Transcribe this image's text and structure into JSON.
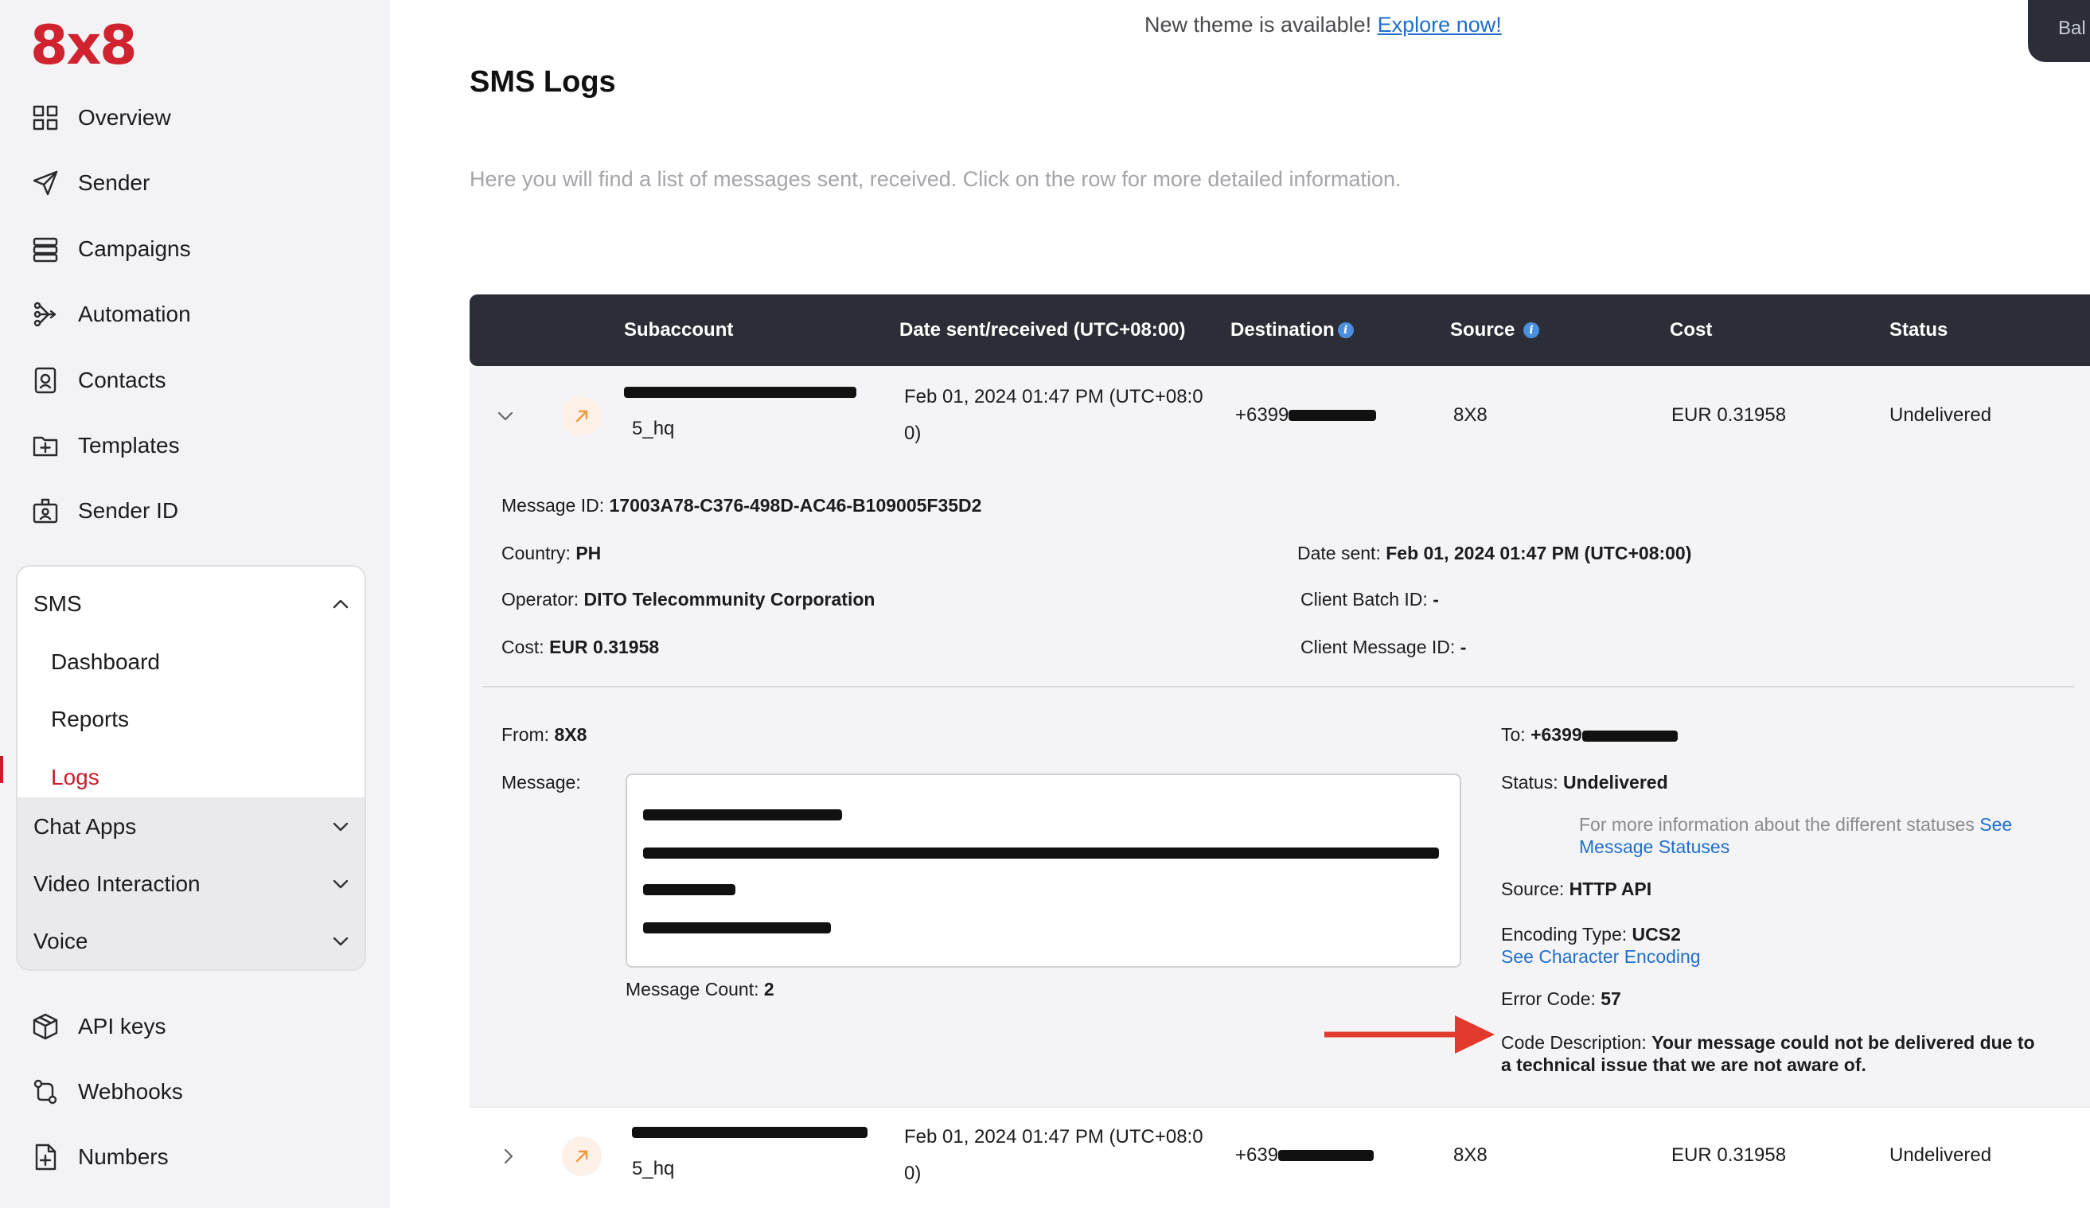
{
  "app": {
    "logo": "8x8"
  },
  "sidebar": {
    "items": [
      {
        "label": "Overview",
        "icon": "grid-icon"
      },
      {
        "label": "Sender",
        "icon": "send-icon"
      },
      {
        "label": "Campaigns",
        "icon": "stack-icon"
      },
      {
        "label": "Automation",
        "icon": "flow-icon"
      },
      {
        "label": "Contacts",
        "icon": "contacts-icon"
      },
      {
        "label": "Templates",
        "icon": "folder-plus-icon"
      },
      {
        "label": "Sender ID",
        "icon": "id-badge-icon"
      }
    ],
    "sms_group": {
      "label": "SMS",
      "subitems": [
        "Dashboard",
        "Reports",
        "Logs"
      ],
      "active": "Logs"
    },
    "groups": [
      "Chat Apps",
      "Video Interaction",
      "Voice"
    ],
    "bottom_items": [
      {
        "label": "API keys",
        "icon": "cube-icon"
      },
      {
        "label": "Webhooks",
        "icon": "webhook-icon"
      },
      {
        "label": "Numbers",
        "icon": "file-plus-icon"
      }
    ]
  },
  "banner": {
    "text": "New theme is available! ",
    "link": "Explore now!"
  },
  "top_right": {
    "label": "Bal"
  },
  "page": {
    "title": "SMS Logs",
    "subtitle": "Here you will find a list of messages sent, received. Click on the row for more detailed information."
  },
  "table": {
    "headers": {
      "subaccount": "Subaccount",
      "date": "Date sent/received (UTC+08:00)",
      "destination": "Destination",
      "source": "Source",
      "cost": "Cost",
      "status": "Status"
    },
    "rows": [
      {
        "sub_line2": "5_hq",
        "date_l1": "Feb 01, 2024 01:47 PM (UTC+08:0",
        "date_l2": "0)",
        "dest": "+6399",
        "source": "8X8",
        "cost": "EUR 0.31958",
        "status": "Undelivered"
      },
      {
        "sub_line2": "5_hq",
        "date_l1": "Feb 01, 2024 01:47 PM (UTC+08:0",
        "date_l2": "0)",
        "dest": "+639",
        "source": "8X8",
        "cost": "EUR 0.31958",
        "status": "Undelivered"
      }
    ]
  },
  "detail": {
    "message_id_label": "Message ID: ",
    "message_id": "17003A78-C376-498D-AC46-B109005F35D2",
    "country_label": "Country: ",
    "country": "PH",
    "operator_label": "Operator: ",
    "operator": "DITO Telecommunity Corporation",
    "cost_label": "Cost: ",
    "cost": "EUR 0.31958",
    "date_sent_label": "Date sent: ",
    "date_sent": "Feb 01, 2024 01:47 PM (UTC+08:00)",
    "client_batch_label": "Client Batch ID: ",
    "client_batch": "-",
    "client_msg_label": "Client Message ID: ",
    "client_msg": "-",
    "from_label": "From: ",
    "from": "8X8",
    "message_label": "Message:",
    "message_count_label": "Message Count: ",
    "message_count": "2",
    "to_label": "To: ",
    "to": "+6399",
    "status_label": "Status: ",
    "status": "Undelivered",
    "status_info": "For more information about the different statuses ",
    "status_link_1": "See",
    "status_link_2": "Message Statuses",
    "source_label": "Source: ",
    "source": "HTTP API",
    "encoding_label": "Encoding Type: ",
    "encoding": "UCS2",
    "encoding_link": "See Character Encoding",
    "error_label": "Error Code: ",
    "error": "57",
    "code_desc_label": "Code Description: ",
    "code_desc_1": "Your message could not be delivered due to",
    "code_desc_2": "a technical issue that we are not aware of."
  },
  "colors": {
    "brand": "#d0222f",
    "header_bg": "#2b2e36",
    "link": "#1f6fce",
    "annotation_arrow": "#e23b2e"
  }
}
